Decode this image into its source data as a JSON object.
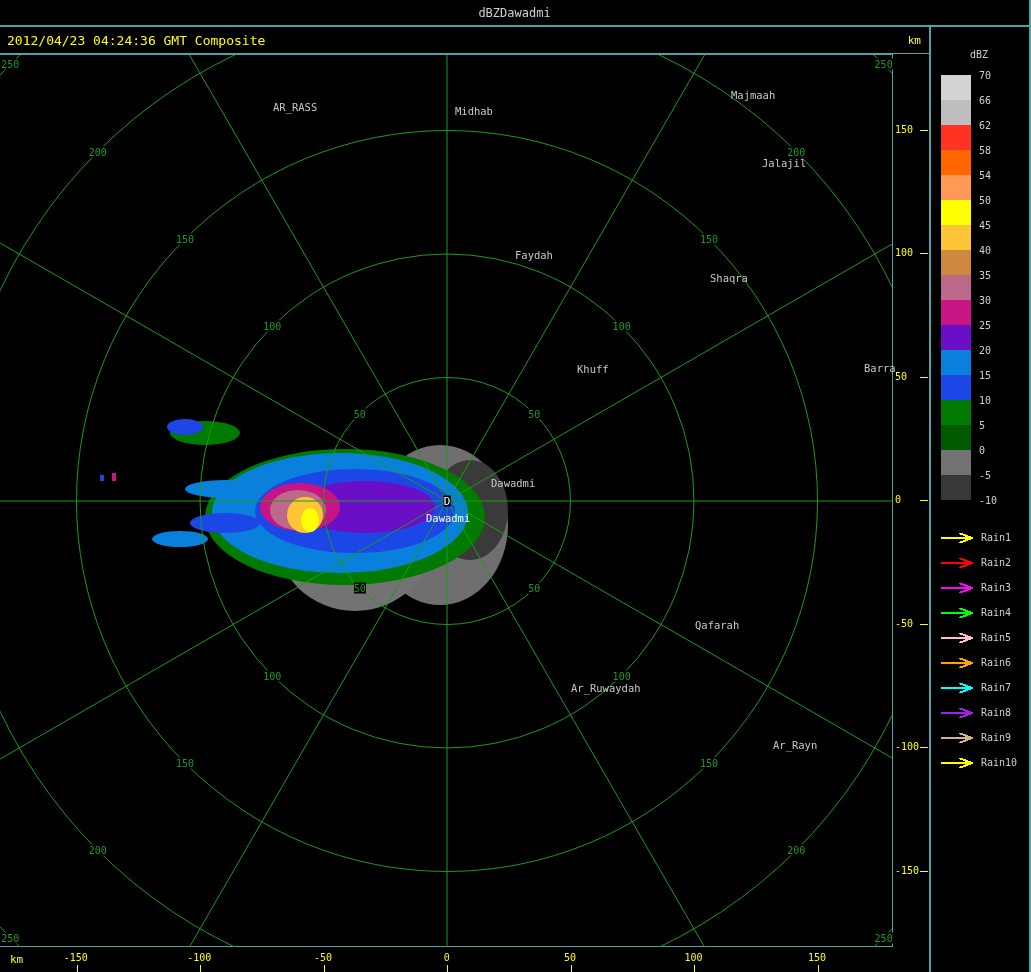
{
  "window": {
    "title": "dBZDawadmi"
  },
  "header": {
    "timestamp": "2012/04/23 04:24:36 GMT Composite",
    "unit": "km"
  },
  "map": {
    "rings": [
      {
        "labels": [
          "50",
          "50",
          "50",
          "50"
        ]
      },
      {
        "labels": [
          "100",
          "100",
          "100",
          "100"
        ]
      },
      {
        "labels": [
          "150",
          "150",
          "150",
          "150"
        ]
      },
      {
        "labels": [
          "200",
          "200",
          "200",
          "200"
        ]
      },
      {
        "labels": [
          "250",
          "250",
          "250",
          "250"
        ]
      }
    ],
    "places": [
      {
        "name": "AR_RASS",
        "kind": "city"
      },
      {
        "name": "Midhab",
        "kind": "city"
      },
      {
        "name": "Majmaah",
        "kind": "city"
      },
      {
        "name": "Jalajil",
        "kind": "city"
      },
      {
        "name": "Faydah",
        "kind": "city"
      },
      {
        "name": "Shaqra",
        "kind": "city"
      },
      {
        "name": "Khuff",
        "kind": "city"
      },
      {
        "name": "Barra",
        "kind": "city"
      },
      {
        "name": "Dawadmi",
        "kind": "city"
      },
      {
        "name": "Dawadmi",
        "kind": "site",
        "marker": "D"
      },
      {
        "name": "Qafarah",
        "kind": "city"
      },
      {
        "name": "Ar_Ruwaydah",
        "kind": "city"
      },
      {
        "name": "Ar_Rayn",
        "kind": "city"
      }
    ],
    "y_axis": {
      "ticks": [
        "150",
        "100",
        "50",
        "0",
        "-50",
        "-100",
        "-150"
      ]
    },
    "x_axis": {
      "unit": "km",
      "ticks": [
        "-150",
        "-100",
        "-50",
        "0",
        "50",
        "100",
        "150"
      ]
    }
  },
  "legend": {
    "title": "dBZ",
    "bins": [
      {
        "color": "#d3d3d3"
      },
      {
        "color": "#bebebe"
      },
      {
        "color": "#ff3322"
      },
      {
        "color": "#ff6600"
      },
      {
        "color": "#ff9955"
      },
      {
        "color": "#ffff00"
      },
      {
        "color": "#fbc535"
      },
      {
        "color": "#cd8a3f"
      },
      {
        "color": "#bd6a8a"
      },
      {
        "color": "#c71585"
      },
      {
        "color": "#6a0fc5"
      },
      {
        "color": "#0880dc"
      },
      {
        "color": "#1c46e6"
      },
      {
        "color": "#007a00"
      },
      {
        "color": "#005a00"
      },
      {
        "color": "#737373"
      },
      {
        "color": "#383838"
      }
    ],
    "labels": [
      "70",
      "66",
      "62",
      "58",
      "54",
      "50",
      "45",
      "40",
      "35",
      "30",
      "25",
      "20",
      "15",
      "10",
      "5",
      "0",
      "-5",
      "-10"
    ],
    "tracks": [
      {
        "label": "Rain1",
        "color": "#ffff00"
      },
      {
        "label": "Rain2",
        "color": "#ff0000"
      },
      {
        "label": "Rain3",
        "color": "#ff00ff"
      },
      {
        "label": "Rain4",
        "color": "#00ff00"
      },
      {
        "label": "Rain5",
        "color": "#ffc0cb"
      },
      {
        "label": "Rain6",
        "color": "#ffa500"
      },
      {
        "label": "Rain7",
        "color": "#00ffff"
      },
      {
        "label": "Rain8",
        "color": "#a020f0"
      },
      {
        "label": "Rain9",
        "color": "#d2b48c"
      },
      {
        "label": "Rain10",
        "color": "#ffff00"
      }
    ]
  }
}
